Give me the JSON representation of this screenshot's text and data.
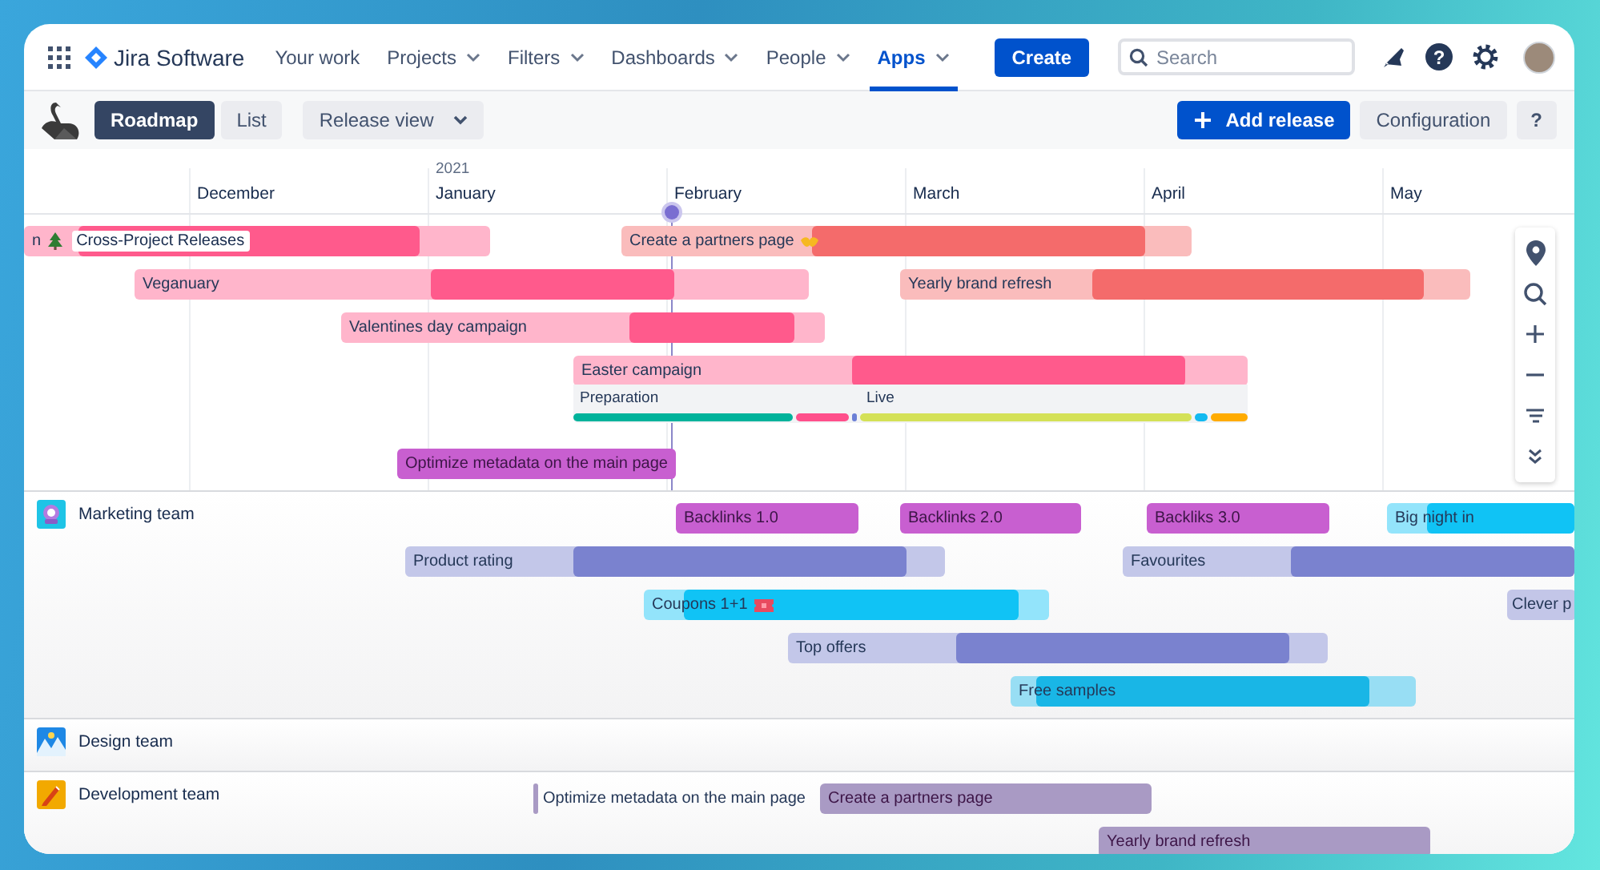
{
  "nav": {
    "product": "Jira Software",
    "items": [
      {
        "label": "Your work",
        "dropdown": false,
        "selected": false
      },
      {
        "label": "Projects",
        "dropdown": true,
        "selected": false
      },
      {
        "label": "Filters",
        "dropdown": true,
        "selected": false
      },
      {
        "label": "Dashboards",
        "dropdown": true,
        "selected": false
      },
      {
        "label": "People",
        "dropdown": true,
        "selected": false
      },
      {
        "label": "Apps",
        "dropdown": true,
        "selected": true
      }
    ],
    "create": "Create",
    "search": {
      "placeholder": "Search"
    },
    "help": "?"
  },
  "toolbar": {
    "views": [
      {
        "label": "Roadmap",
        "selected": true
      },
      {
        "label": "List",
        "selected": false
      }
    ],
    "release_view": "Release view",
    "add_release": "Add release",
    "configuration": "Configuration",
    "help": "?"
  },
  "timeline": {
    "months": [
      {
        "label": "December"
      },
      {
        "label": "January",
        "year": "2021"
      },
      {
        "label": "February"
      },
      {
        "label": "March"
      },
      {
        "label": "April"
      },
      {
        "label": "May"
      }
    ],
    "sections": [
      {
        "rows": [
          {
            "bars": [
              {
                "kind": "range",
                "label": "n",
                "tag": "Cross-Project Releases",
                "color": "#ff5a8c"
              },
              {
                "kind": "range",
                "label": "Create a partners page",
                "color": "#f46b6b"
              }
            ]
          },
          {
            "bars": [
              {
                "kind": "range",
                "label": "Veganuary",
                "color": "#ff5a8c"
              },
              {
                "kind": "range",
                "label": "Yearly brand refresh",
                "color": "#f46b6b"
              }
            ]
          },
          {
            "bars": [
              {
                "kind": "range",
                "label": "Valentines day campaign",
                "color": "#ff5a8c"
              }
            ]
          },
          {
            "bars": [
              {
                "kind": "range",
                "label": "Easter campaign",
                "color": "#ff5a8c"
              }
            ],
            "phases": [
              {
                "label": "Preparation",
                "color": "#00b39b"
              },
              {
                "color": "#ff4f8b"
              },
              {
                "color": "#6b7fd6"
              },
              {
                "label": "Live",
                "color": "#d4e157"
              },
              {
                "color": "#13b9f0"
              },
              {
                "color": "#ffab00"
              }
            ]
          },
          {
            "bars": [
              {
                "kind": "solid",
                "label": "Optimize metadata on the main page",
                "color": "#c85fd0"
              }
            ]
          }
        ]
      },
      {
        "team": "Marketing team",
        "rows": [
          {
            "bars": [
              {
                "kind": "solid",
                "label": "Backlinks 1.0",
                "color": "#c85fd0"
              },
              {
                "kind": "solid",
                "label": "Backlinks 2.0",
                "color": "#c85fd0"
              },
              {
                "kind": "solid",
                "label": "Backliks 3.0",
                "color": "#c85fd0"
              },
              {
                "kind": "range",
                "label": "Big night in",
                "color": "#10c3f5"
              }
            ]
          },
          {
            "bars": [
              {
                "kind": "range",
                "label": "Product rating",
                "color": "#7a82cf"
              },
              {
                "kind": "range",
                "label": "Favourites",
                "color": "#7a82cf"
              }
            ]
          },
          {
            "bars": [
              {
                "kind": "range",
                "label": "Coupons 1+1",
                "color": "#10c3f5"
              },
              {
                "kind": "planned",
                "label": "Clever p",
                "color": "#c3c6e8"
              }
            ]
          },
          {
            "bars": [
              {
                "kind": "range",
                "label": "Top offers",
                "color": "#7a82cf"
              }
            ]
          },
          {
            "bars": [
              {
                "kind": "range",
                "label": "Free samples",
                "color": "#19b6e6"
              }
            ]
          }
        ]
      },
      {
        "team": "Design team"
      },
      {
        "team": "Development team",
        "rows": [
          {
            "bars": [
              {
                "kind": "marker",
                "label": "Optimize metadata on the main page",
                "color": "#a99ac4"
              },
              {
                "kind": "solid",
                "label": "Create a partners page",
                "color": "#a99ac4"
              }
            ]
          },
          {
            "bars": [
              {
                "kind": "solid",
                "label": "Yearly brand refresh",
                "color": "#a99ac4"
              }
            ]
          }
        ]
      }
    ]
  }
}
